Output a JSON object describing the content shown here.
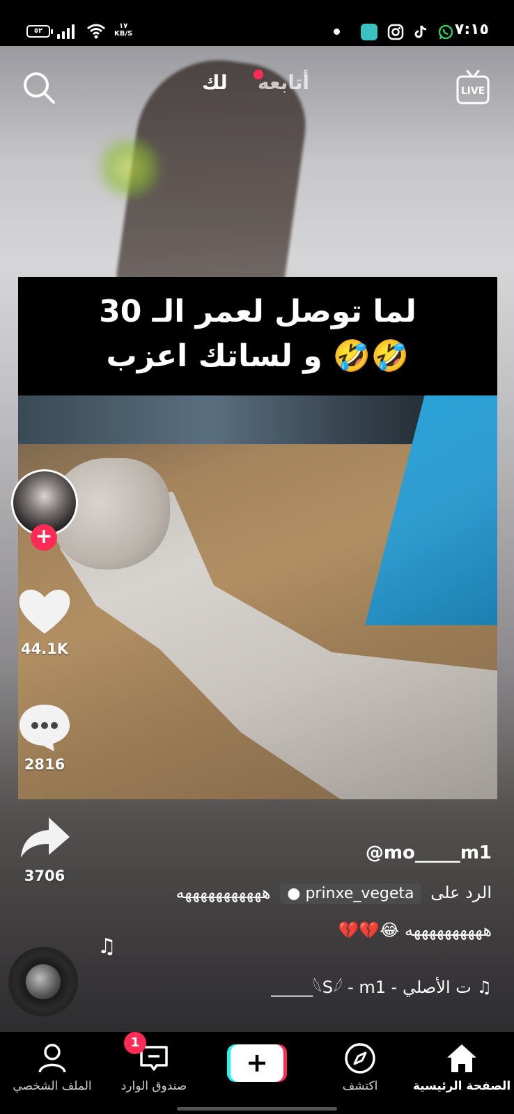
{
  "status_bar": {
    "time": "٧:١٥",
    "battery": "٥٢",
    "net_speed_value": "١٧",
    "net_speed_unit": "KB/S"
  },
  "top_nav": {
    "tab_for_you": "لك",
    "tab_following": "أتابعه",
    "live_label": "LIVE"
  },
  "video": {
    "overlay_line1": "لما توصل لعمر الـ 30",
    "overlay_line2": "و لساتك اعزب 🤣🤣"
  },
  "actions": {
    "likes": "44.1K",
    "comments": "2816",
    "shares": "3706"
  },
  "caption": {
    "username": "@mo_____m1",
    "reply_prefix": "الرد على",
    "reply_user": "prinxe_vegeta",
    "reply_text": "هههههههههههه",
    "line2": "ههههههههههه 😂💔💔",
    "sound": "♫ ت الأصلي - 𓆩S𓆪 - m1_____"
  },
  "bottom_nav": {
    "home": "الصفحة الرئيسية",
    "discover": "اكتشف",
    "inbox": "صندوق الوارد",
    "inbox_badge": "1",
    "profile": "الملف الشخصي"
  },
  "colors": {
    "accent": "#fe2c55",
    "cyan": "#25f4ee"
  }
}
